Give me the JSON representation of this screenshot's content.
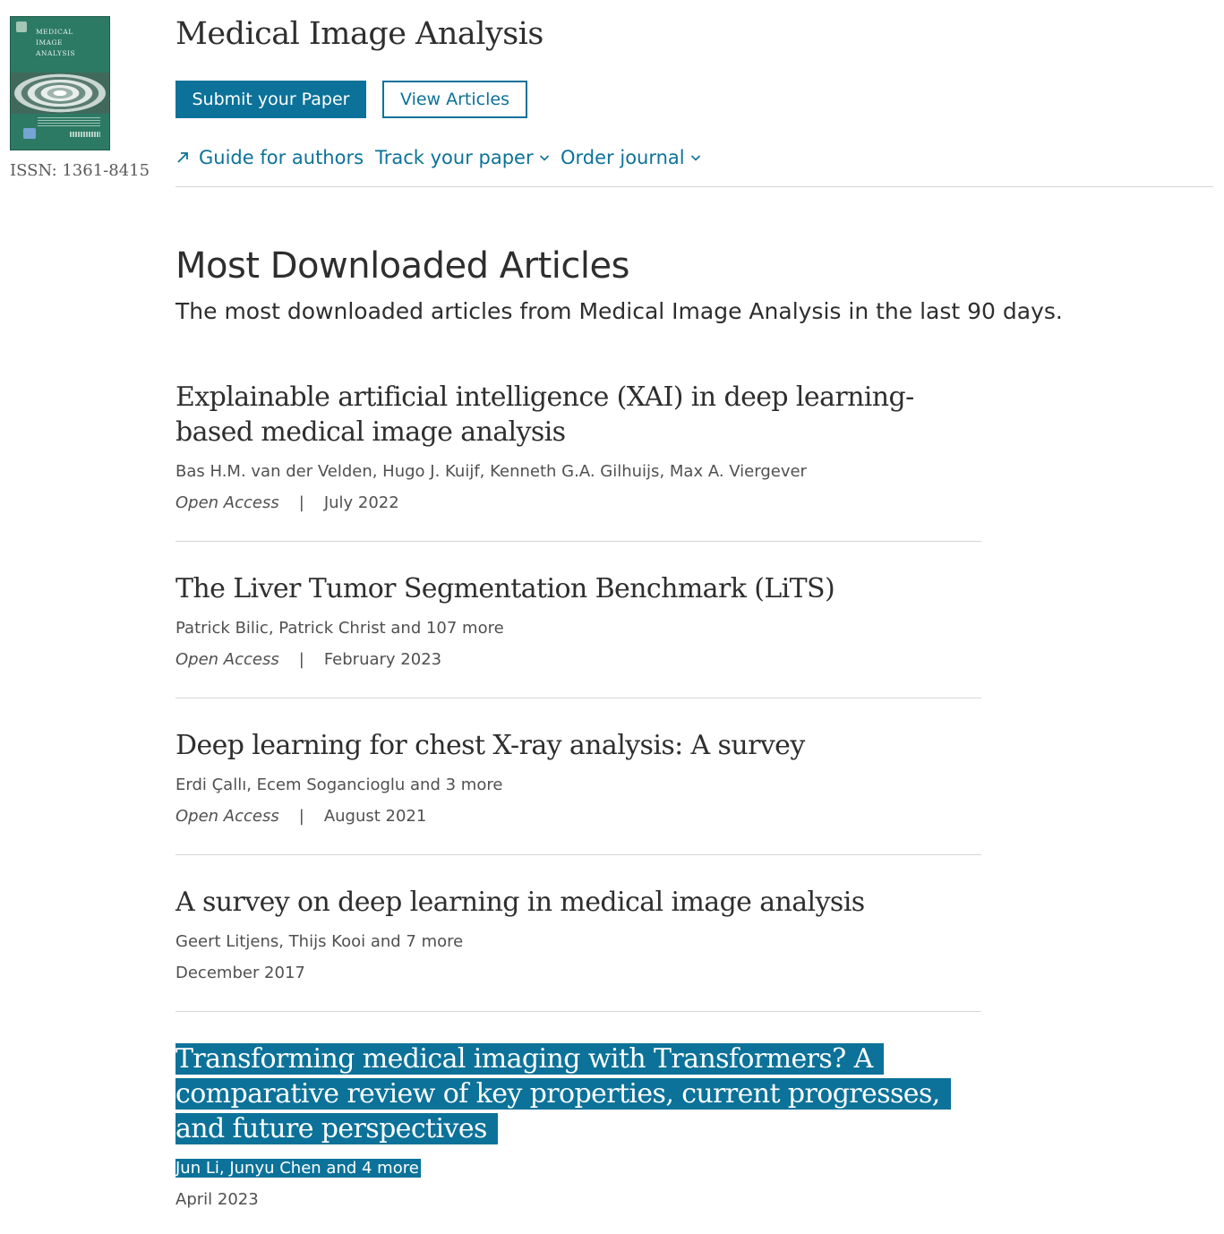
{
  "journal": {
    "cover_text": [
      "MEDICAL",
      "IMAGE",
      "ANALYSIS"
    ],
    "title": "Medical Image Analysis",
    "issn": "ISSN: 1361-8415"
  },
  "actions": {
    "submit_label": "Submit your Paper",
    "view_label": "View Articles"
  },
  "nav": {
    "guide": "Guide for authors",
    "track": "Track your paper",
    "order": "Order journal"
  },
  "section": {
    "title": "Most Downloaded Articles",
    "subtitle": "The most downloaded articles from Medical Image Analysis in the last 90 days."
  },
  "articles": [
    {
      "title": "Explainable artificial intelligence (XAI) in deep learning-based medical image analysis",
      "authors": "Bas H.M. van der Velden, Hugo J. Kuijf, Kenneth G.A. Gilhuijs, Max A. Viergever",
      "access": "Open Access",
      "separator": "|",
      "date": "July 2022"
    },
    {
      "title": "The Liver Tumor Segmentation Benchmark (LiTS)",
      "authors": "Patrick Bilic, Patrick Christ and 107 more",
      "access": "Open Access",
      "separator": "|",
      "date": "February 2023"
    },
    {
      "title": "Deep learning for chest X-ray analysis: A survey",
      "authors": "Erdi Çallı, Ecem Sogancioglu and 3 more",
      "access": "Open Access",
      "separator": "|",
      "date": "August 2021"
    },
    {
      "title": "A survey on deep learning in medical image analysis",
      "authors": "Geert Litjens, Thijs Kooi and 7 more",
      "date": "December 2017"
    },
    {
      "title": "Transforming medical imaging with Transformers? A comparative review of key properties, current progresses, and future perspectives",
      "authors": "Jun Li, Junyu Chen and 4 more",
      "date": "April 2023"
    }
  ],
  "colors": {
    "accent": "#0c7299",
    "text": "#2e2e2e",
    "muted": "#505050",
    "divider": "#d6d6d6",
    "cover": "#2c7a64"
  }
}
